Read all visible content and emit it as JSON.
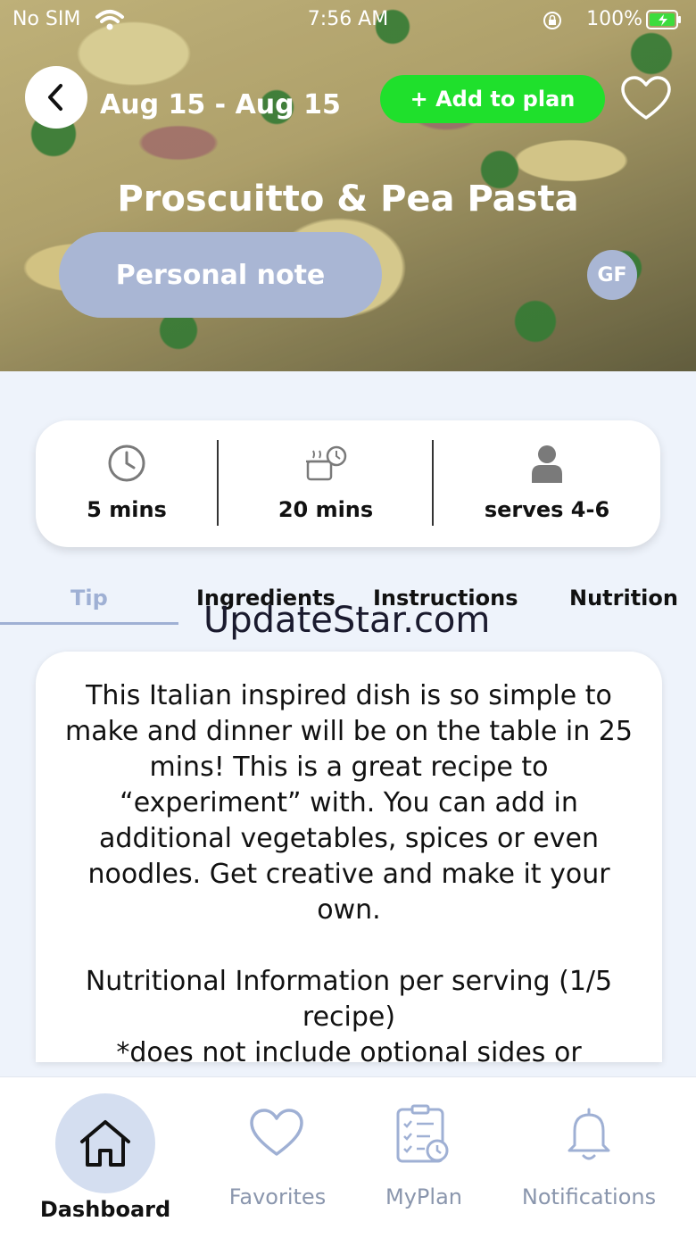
{
  "status_bar": {
    "carrier": "No SIM",
    "time": "7:56 AM",
    "battery": "100%"
  },
  "header": {
    "date_range": "Aug 15 - Aug 15",
    "add_to_plan": "+ Add to plan",
    "recipe_title": "Proscuitto & Pea Pasta",
    "personal_note": "Personal note",
    "diet_badge": "GF"
  },
  "stats": {
    "prep_time": "5 mins",
    "cook_time": "20 mins",
    "servings": "serves 4-6"
  },
  "tabs": [
    {
      "label": "Tip",
      "active": true
    },
    {
      "label": "Ingredients",
      "active": false
    },
    {
      "label": "Instructions",
      "active": false
    },
    {
      "label": "Nutrition",
      "active": false
    }
  ],
  "watermark": "UpdateStar.com",
  "tip": {
    "paragraph1": "This Italian inspired dish is so simple to make and dinner will be on the table in 25 mins! This is a great recipe to “experiment” with. You can add in additional vegetables, spices or even noodles. Get creative and make it your own.",
    "paragraph2": "Nutritional Information per serving (1/5 recipe)",
    "paragraph3": "*does not include optional sides or"
  },
  "bottom_nav": [
    {
      "label": "Dashboard",
      "icon": "home-icon",
      "active": true
    },
    {
      "label": "Favorites",
      "icon": "heart-icon",
      "active": false
    },
    {
      "label": "MyPlan",
      "icon": "checklist-icon",
      "active": false
    },
    {
      "label": "Notifications",
      "icon": "bell-icon",
      "active": false
    }
  ],
  "colors": {
    "accent": "#a9b6d4",
    "add_button": "#1fe02c",
    "background": "#eef3fb"
  }
}
